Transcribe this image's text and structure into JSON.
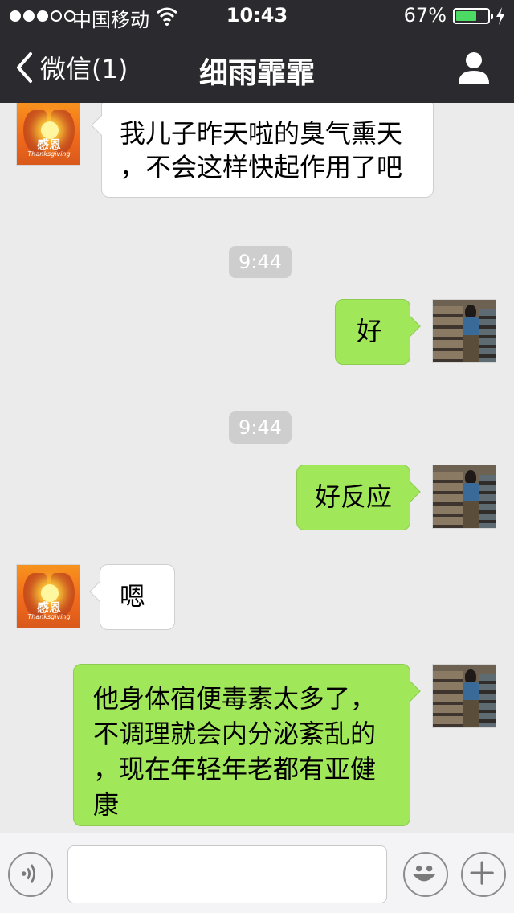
{
  "status_bar": {
    "carrier": "中国移动",
    "time": "10:43",
    "battery_percent": "67%",
    "battery_level": 0.67,
    "signal_bars_filled": 3,
    "signal_bars_total": 5,
    "icons": [
      "signal-dots-icon",
      "wifi-icon",
      "battery-icon",
      "charging-icon"
    ]
  },
  "nav": {
    "back_label": "微信(1)",
    "title": "细雨霏霏",
    "icons": [
      "chevron-left-icon",
      "person-icon"
    ]
  },
  "messages": [
    {
      "type": "received",
      "avatar": "thanks-avatar",
      "text": "我儿子昨天啦的臭气熏天\n，不会这样快起作用了吧"
    },
    {
      "type": "time",
      "text": "9:44"
    },
    {
      "type": "sent",
      "avatar": "photo-avatar",
      "text": "好"
    },
    {
      "type": "time",
      "text": "9:44"
    },
    {
      "type": "sent",
      "avatar": "photo-avatar",
      "text": "好反应"
    },
    {
      "type": "received",
      "avatar": "thanks-avatar",
      "text": "嗯"
    },
    {
      "type": "sent",
      "avatar": "photo-avatar",
      "text": "他身体宿便毒素太多了，\n不调理就会内分泌紊乱的\n，现在年轻年老都有亚健\n康"
    }
  ],
  "avatar_text": {
    "thanks_caption": "感恩",
    "thanks_subcaption": "Thanksgiving"
  },
  "input_bar": {
    "value": "",
    "icons": [
      "voice-icon",
      "emoji-icon",
      "plus-icon"
    ]
  },
  "colors": {
    "nav_background": "#2b2b2f",
    "chat_background": "#ebebeb",
    "sent_bubble": "#a0e75a",
    "received_bubble": "#ffffff",
    "time_badge": "#cecece",
    "battery_fill": "#4cd964"
  }
}
